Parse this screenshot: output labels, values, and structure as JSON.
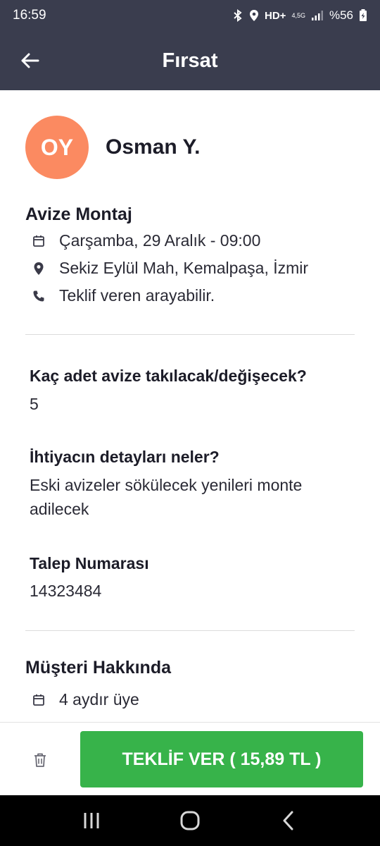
{
  "status": {
    "time": "16:59",
    "network": "HD+",
    "network_sub": "4,5G",
    "battery": "%56"
  },
  "app_bar": {
    "title": "Fırsat"
  },
  "customer": {
    "initials": "OY",
    "name": "Osman Y."
  },
  "job": {
    "title": "Avize Montaj",
    "date": "Çarşamba, 29 Aralık - 09:00",
    "location": "Sekiz Eylül Mah, Kemalpaşa, İzmir",
    "phone_note": "Teklif veren arayabilir."
  },
  "questions": [
    {
      "label": "Kaç adet avize takılacak/değişecek?",
      "value": "5"
    },
    {
      "label": "İhtiyacın detayları neler?",
      "value": "Eski avizeler sökülecek yenileri monte adilecek"
    },
    {
      "label": "Talep Numarası",
      "value": "14323484"
    }
  ],
  "about": {
    "title": "Müşteri Hakkında",
    "membership": "4 aydır üye"
  },
  "actions": {
    "offer_label": "TEKLİF VER ( 15,89 TL )"
  },
  "colors": {
    "header": "#3a3d4e",
    "avatar": "#fb8a61",
    "accent_green": "#37b34a"
  }
}
